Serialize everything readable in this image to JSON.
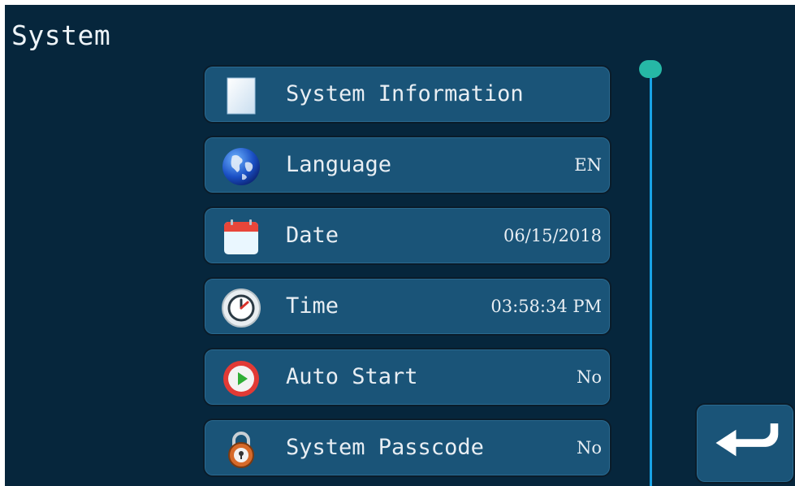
{
  "title": "System",
  "menu": [
    {
      "label": "System Information",
      "value": "",
      "icon": "document-icon"
    },
    {
      "label": "Language",
      "value": "EN",
      "icon": "globe-icon"
    },
    {
      "label": "Date",
      "value": "06/15/2018",
      "icon": "calendar-icon"
    },
    {
      "label": "Time",
      "value": "03:58:34 PM",
      "icon": "clock-icon"
    },
    {
      "label": "Auto Start",
      "value": "No",
      "icon": "play-icon"
    },
    {
      "label": "System Passcode",
      "value": "No",
      "icon": "padlock-icon"
    }
  ],
  "back_button": {
    "icon": "return-arrow-icon"
  },
  "colors": {
    "background": "#06263c",
    "item": "#1a5478",
    "scroll_track": "#19a3e6",
    "scroll_thumb": "#26b8a6"
  }
}
